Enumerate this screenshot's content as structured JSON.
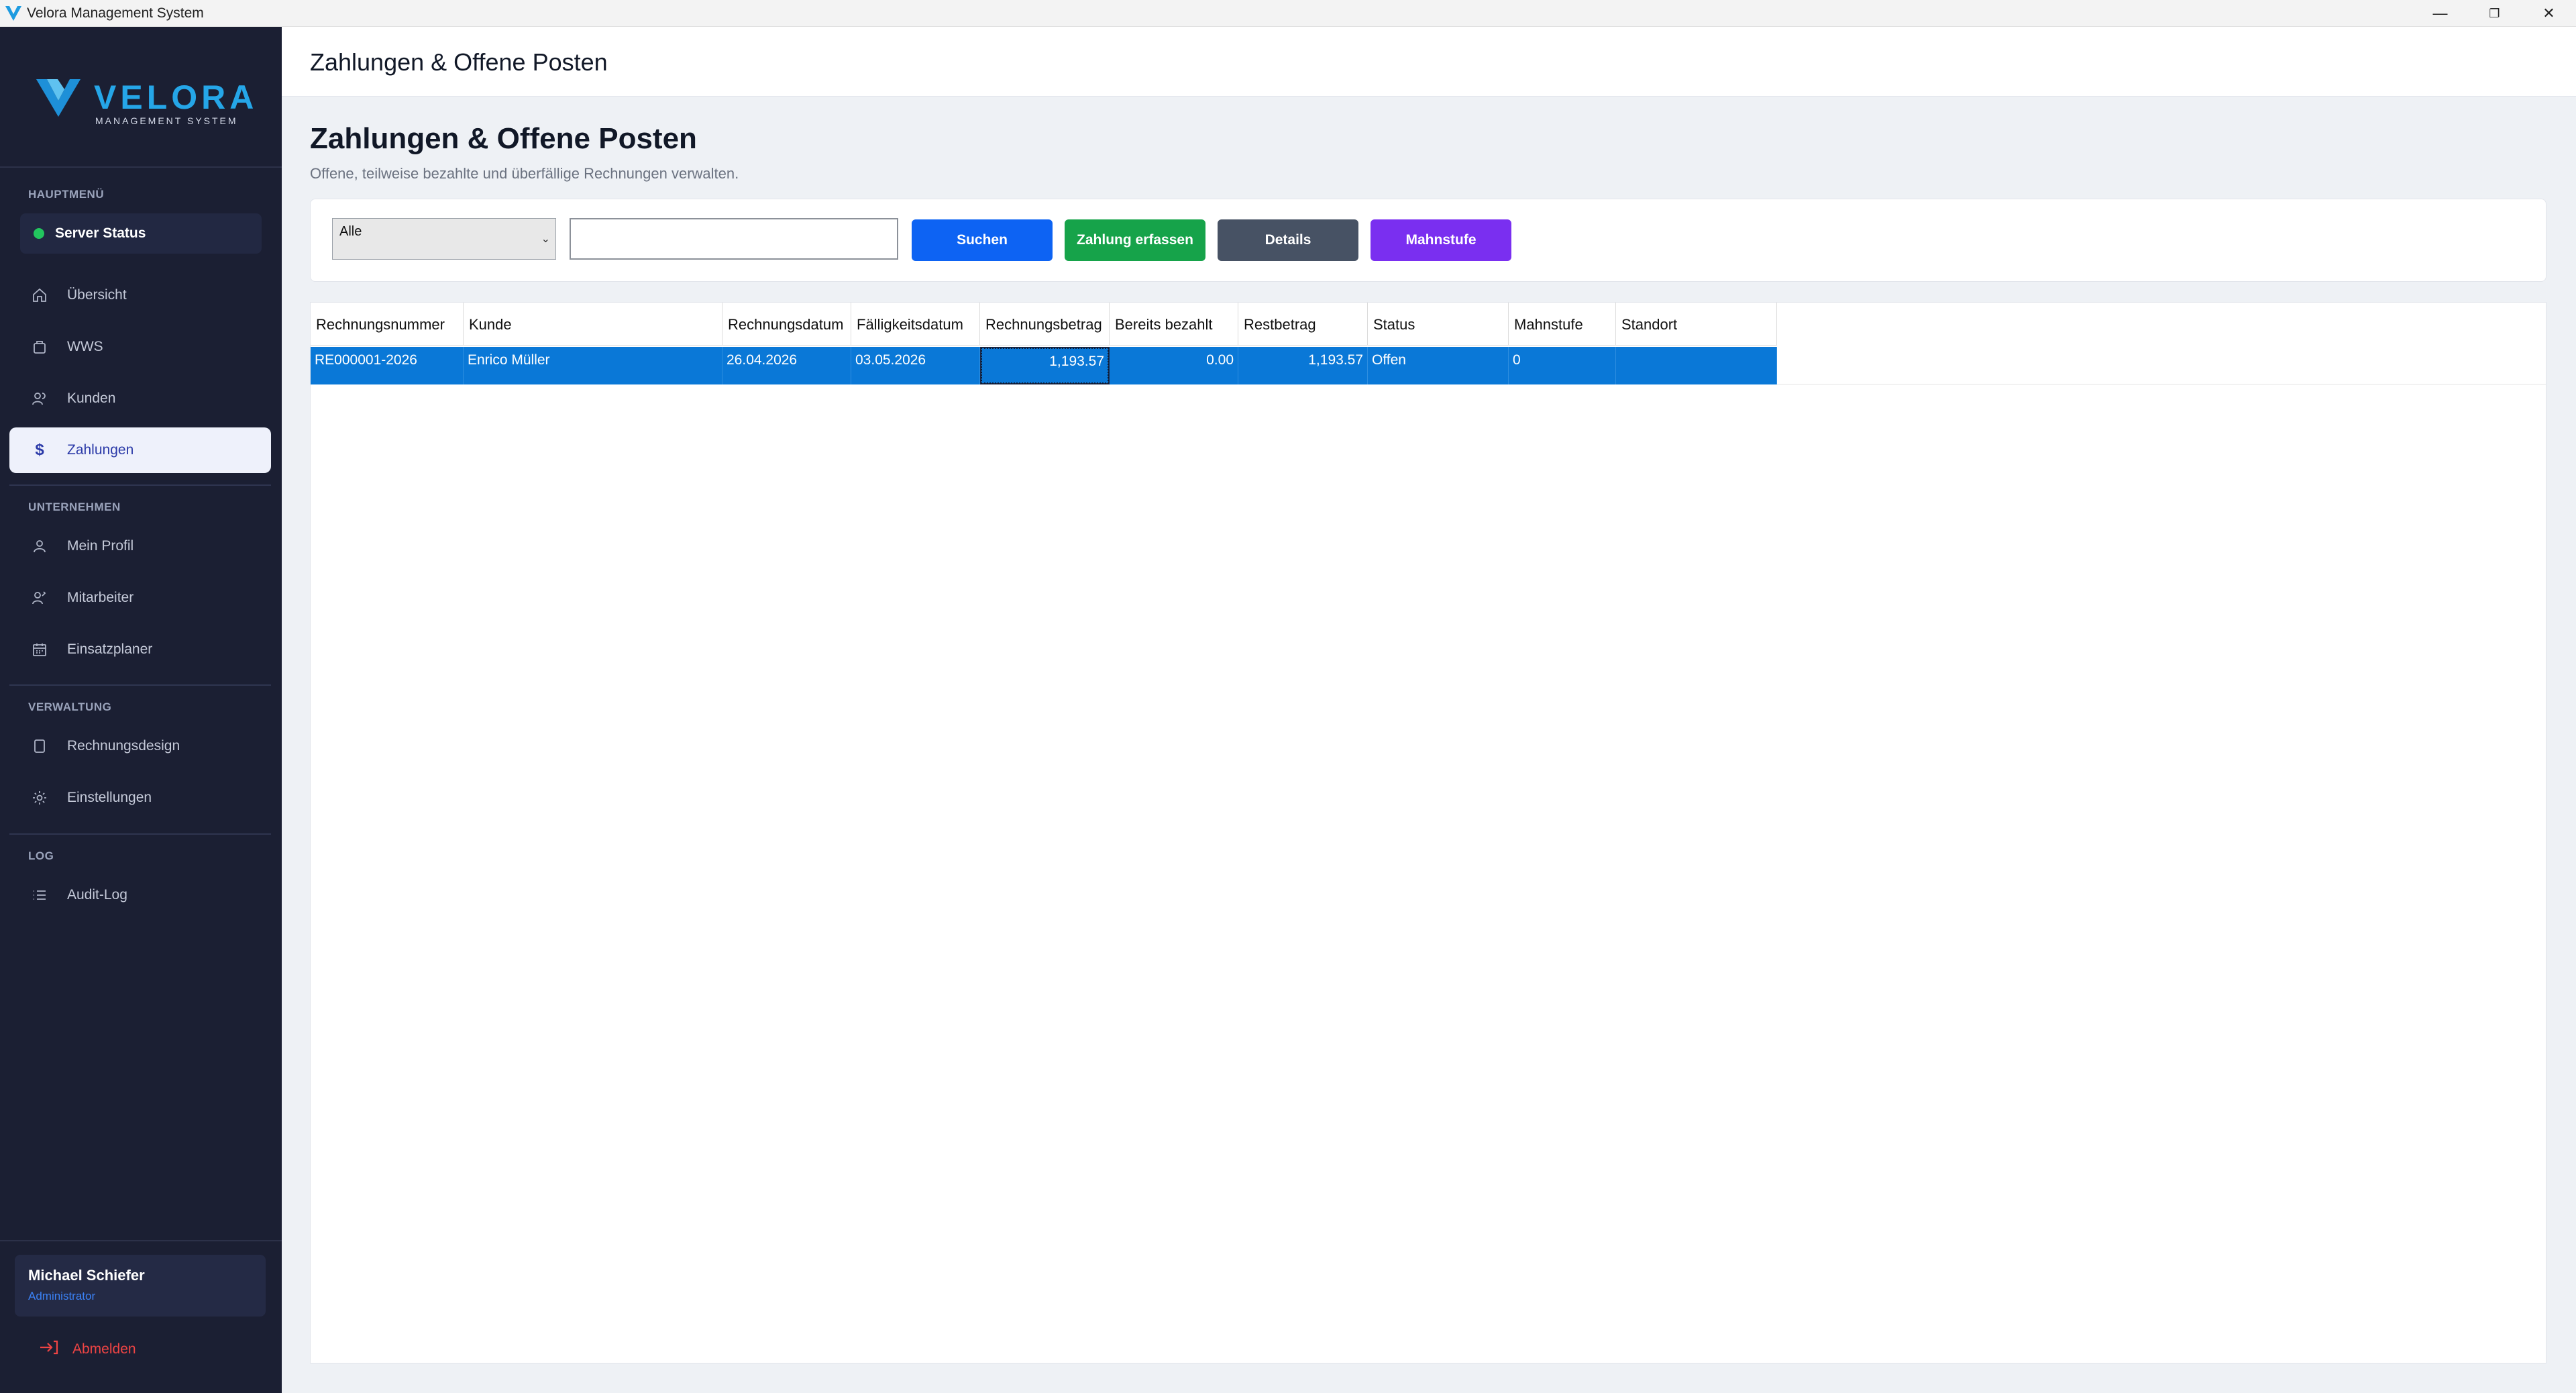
{
  "window": {
    "title": "Velora Management System",
    "controls": {
      "minimize": "—",
      "restore": "❐",
      "close": "✕"
    }
  },
  "brand": {
    "name": "VELORA",
    "tagline": "MANAGEMENT SYSTEM",
    "accent": "#25a6e8"
  },
  "sidebar": {
    "sections": {
      "main": "HAUPTMENÜ",
      "company": "UNTERNEHMEN",
      "admin": "VERWALTUNG",
      "log": "LOG"
    },
    "server_status": "Server Status",
    "items": [
      {
        "label": "Übersicht",
        "icon": "home-icon"
      },
      {
        "label": "WWS",
        "icon": "bag-icon"
      },
      {
        "label": "Kunden",
        "icon": "users-icon"
      },
      {
        "label": "Zahlungen",
        "icon": "dollar-icon"
      },
      {
        "label": "Mein Profil",
        "icon": "user-icon"
      },
      {
        "label": "Mitarbeiter",
        "icon": "staff-icon"
      },
      {
        "label": "Einsatzplaner",
        "icon": "calendar-icon"
      },
      {
        "label": "Rechnungsdesign",
        "icon": "document-icon"
      },
      {
        "label": "Einstellungen",
        "icon": "gear-icon"
      },
      {
        "label": "Audit-Log",
        "icon": "list-icon"
      }
    ],
    "user": {
      "name": "Michael Schiefer",
      "role": "Administrator"
    },
    "logout": "Abmelden"
  },
  "header": {
    "title": "Zahlungen & Offene Posten"
  },
  "page": {
    "title": "Zahlungen & Offene Posten",
    "subtitle": "Offene, teilweise bezahlte und überfällige Rechnungen verwalten."
  },
  "toolbar": {
    "filter_value": "Alle",
    "search_value": "",
    "buttons": {
      "search": "Suchen",
      "record_payment": "Zahlung erfassen",
      "details": "Details",
      "dunning": "Mahnstufe"
    }
  },
  "grid": {
    "columns": [
      "Rechnungsnummer",
      "Kunde",
      "Rechnungsdatum",
      "Fälligkeitsdatum",
      "Rechnungsbetrag",
      "Bereits bezahlt",
      "Restbetrag",
      "Status",
      "Mahnstufe",
      "Standort"
    ],
    "rows": [
      [
        "RE000001-2026",
        "Enrico Müller",
        "26.04.2026",
        "03.05.2026",
        "1,193.57",
        "0.00",
        "1,193.57",
        "Offen",
        "0",
        ""
      ]
    ],
    "selection_color": "#0a78d7"
  }
}
